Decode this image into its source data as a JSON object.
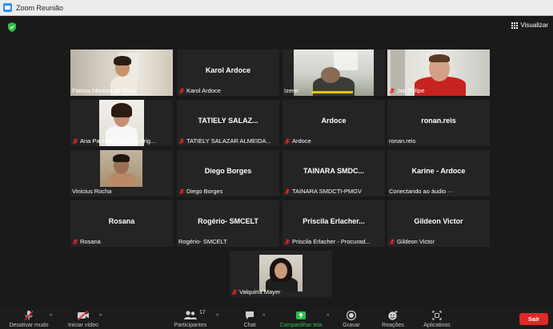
{
  "window": {
    "title": "Zoom Reunião"
  },
  "view": {
    "label": "Visualizar"
  },
  "participants": [
    {
      "label": "Fátima Moreira da Silva",
      "muted": false,
      "active": true
    },
    {
      "name": "Karol Ardoce",
      "label": "Karol Ardoce",
      "muted": true
    },
    {
      "label": "Izenir",
      "muted": false
    },
    {
      "label": "Jair Felipe",
      "muted": true
    },
    {
      "label": "Ana Paula Miranda Rodrig...",
      "muted": true
    },
    {
      "name": "TATIELY SALAZ...",
      "label": "TATIELY SALAZAR ALMEIDA...",
      "muted": true
    },
    {
      "name": "Ardoce",
      "label": "Ardoce",
      "muted": true
    },
    {
      "name": "ronan.reis",
      "label": "ronan.reis",
      "muted": false
    },
    {
      "label": "Vinicius Rocha",
      "muted": false
    },
    {
      "name": "Diego Borges",
      "label": "Diego Borges",
      "muted": true
    },
    {
      "name": "TAINARA SMDC...",
      "label": "TAINARA SMDCTI-PMGV",
      "muted": true
    },
    {
      "name": "Karine - Ardoce",
      "label": "Conectando ao áudio ···",
      "muted": false
    },
    {
      "name": "Rosana",
      "label": "Rosana",
      "muted": true
    },
    {
      "name": "Rogério- SMCELT",
      "label": "Rogério- SMCELT",
      "muted": false
    },
    {
      "name": "Priscila Erlacher...",
      "label": "Priscila Erlacher - Procurad...",
      "muted": true
    },
    {
      "name": "Gildeon Victor",
      "label": "Gildeon Victor",
      "muted": true
    },
    {
      "label": "Valquiria Mayer",
      "muted": true
    }
  ],
  "toolbar": {
    "mute": "Desativar mudo",
    "video": "Iniciar vídeo",
    "participants": "Participantes",
    "participants_count": "17",
    "chat": "Chat",
    "share": "Compartilhar tela",
    "record": "Gravar",
    "reactions": "Reações",
    "apps": "Aplicativos",
    "leave": "Sair"
  },
  "colors": {
    "active_speaker": "#b4df2b",
    "share_green": "#2fbf4a",
    "leave_red": "#e02828",
    "muted_red": "#e02828"
  }
}
